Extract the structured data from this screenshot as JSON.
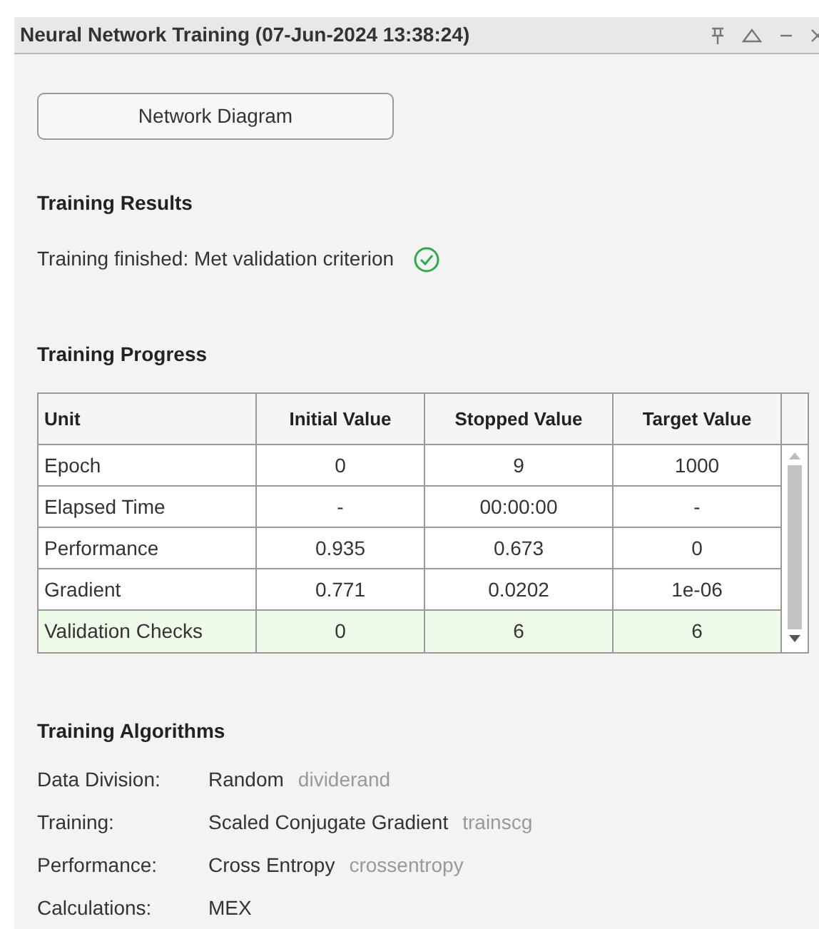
{
  "window": {
    "title": "Neural Network Training (07-Jun-2024 13:38:24)"
  },
  "button": {
    "label": "Network Diagram"
  },
  "results": {
    "heading": "Training Results",
    "message": "Training finished: Met validation criterion",
    "success": true
  },
  "progress": {
    "heading": "Training Progress",
    "table": {
      "columns": [
        "Unit",
        "Initial Value",
        "Stopped Value",
        "Target Value"
      ],
      "rows": [
        {
          "cells": [
            "Epoch",
            "0",
            "9",
            "1000"
          ],
          "highlighted": false
        },
        {
          "cells": [
            "Elapsed Time",
            "-",
            "00:00:00",
            "-"
          ],
          "highlighted": false
        },
        {
          "cells": [
            "Performance",
            "0.935",
            "0.673",
            "0"
          ],
          "highlighted": false
        },
        {
          "cells": [
            "Gradient",
            "0.771",
            "0.0202",
            "1e-06"
          ],
          "highlighted": false
        },
        {
          "cells": [
            "Validation Checks",
            "0",
            "6",
            "6"
          ],
          "highlighted": true
        }
      ]
    }
  },
  "algorithms": {
    "heading": "Training Algorithms",
    "items": [
      {
        "label": "Data Division:",
        "value": "Random",
        "function": "dividerand"
      },
      {
        "label": "Training:",
        "value": "Scaled Conjugate Gradient",
        "function": "trainscg"
      },
      {
        "label": "Performance:",
        "value": "Cross Entropy",
        "function": "crossentropy"
      },
      {
        "label": "Calculations:",
        "value": "MEX"
      }
    ]
  }
}
